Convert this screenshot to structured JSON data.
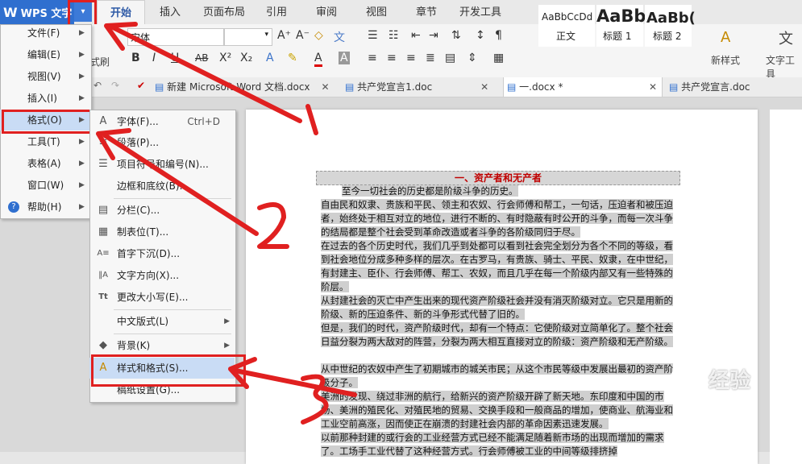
{
  "app": {
    "logo": "W",
    "title": "WPS 文字",
    "dropdown": "▾"
  },
  "tabs": [
    "开始",
    "插入",
    "页面布局",
    "引用",
    "审阅",
    "视图",
    "章节",
    "开发工具"
  ],
  "ribbon": {
    "font_name": "宋体",
    "clear_format_label": "式刷",
    "bold": "B",
    "italic": "I",
    "underline": "U",
    "strike": "AB",
    "superscript": "X²",
    "subscript": "X₂",
    "text_effect": "A",
    "font_color": "A",
    "styles": [
      {
        "preview": "AaBbCcDd",
        "name": "正文"
      },
      {
        "preview": "AaBb",
        "name": "标题 1"
      },
      {
        "preview": "AaBb(",
        "name": "标题 2"
      }
    ],
    "new_style_label": "新样式",
    "text_tools_label": "文字工具"
  },
  "doc_tabs": [
    "新建 Microsoft Word 文档.docx",
    "共产党宣言1.doc",
    "一.docx *",
    "共产党宣言.doc"
  ],
  "main_menu": [
    {
      "label": "文件(F)"
    },
    {
      "label": "编辑(E)"
    },
    {
      "label": "视图(V)"
    },
    {
      "label": "插入(I)"
    },
    {
      "label": "格式(O)"
    },
    {
      "label": "工具(T)"
    },
    {
      "label": "表格(A)"
    },
    {
      "label": "窗口(W)"
    },
    {
      "label": "帮助(H)"
    }
  ],
  "format_menu": [
    {
      "icon": "A",
      "label": "字体(F)...",
      "shortcut": "Ctrl+D"
    },
    {
      "icon": "≡",
      "label": "段落(P)..."
    },
    {
      "icon": "☰",
      "label": "项目符号和编号(N)..."
    },
    {
      "icon": "",
      "label": "边框和底纹(B)..."
    },
    {
      "icon": "▤",
      "label": "分栏(C)..."
    },
    {
      "icon": "▦",
      "label": "制表位(T)..."
    },
    {
      "icon": "A≡",
      "label": "首字下沉(D)..."
    },
    {
      "icon": "‖A",
      "label": "文字方向(X)..."
    },
    {
      "icon": "Tt",
      "label": "更改大小写(E)..."
    },
    {
      "icon": "",
      "label": "中文版式(L)"
    },
    {
      "icon": "◆",
      "label": "背景(K)"
    },
    {
      "icon": "A",
      "label": "样式和格式(S)..."
    },
    {
      "icon": "",
      "label": "稿纸设置(G)..."
    }
  ],
  "document": {
    "heading": "一、资产者和无产者",
    "paragraphs": [
      "至今一切社会的历史都是阶级斗争的历史。",
      "自由民和奴隶、贵族和平民、领主和农奴、行会师傅和帮工，一句话，压迫者和被压迫者，始终处于相互对立的地位，进行不断的、有时隐蔽有时公开的斗争，而每一次斗争的结局都是整个社会受到革命改造或者斗争的各阶级同归于尽。",
      "在过去的各个历史时代，我们几乎到处都可以看到社会完全划分为各个不同的等级，看到社会地位分成多种多样的层次。在古罗马，有贵族、骑士、平民、奴隶，在中世纪，有封建主、臣仆、行会师傅、帮工、农奴，而且几乎在每一个阶级内部又有一些特殊的阶层。",
      "从封建社会的灭亡中产生出来的现代资产阶级社会并没有消灭阶级对立。它只是用新的阶级、新的压迫条件、新的斗争形式代替了旧的。",
      "但是，我们的时代，资产阶级时代，却有一个特点：它使阶级对立简单化了。整个社会日益分裂为两大敌对的阵营，分裂为两大相互直接对立的阶级：资产阶级和无产阶级。",
      "从中世纪的农奴中产生了初期城市的城关市民；从这个市民等级中发展出最初的资产阶级分子。",
      "美洲的发现、绕过非洲的航行，给新兴的资产阶级开辟了新天地。东印度和中国的市场、美洲的殖民化、对殖民地的贸易、交换手段和一般商品的增加，使商业、航海业和工业空前高涨，因而使正在崩溃的封建社会内部的革命因素迅速发展。",
      "以前那种封建的或行会的工业经营方式已经不能满足随着新市场的出现而增加的需求了。工场手工业代替了这种经营方式。行会师傅被工业的中间等级排挤掉"
    ]
  },
  "annotations": [
    "1",
    "2",
    "3"
  ],
  "watermark": "经验",
  "colors": {
    "accent": "#2f6fcf",
    "highlight": "#e02020",
    "heading": "#c00000"
  }
}
